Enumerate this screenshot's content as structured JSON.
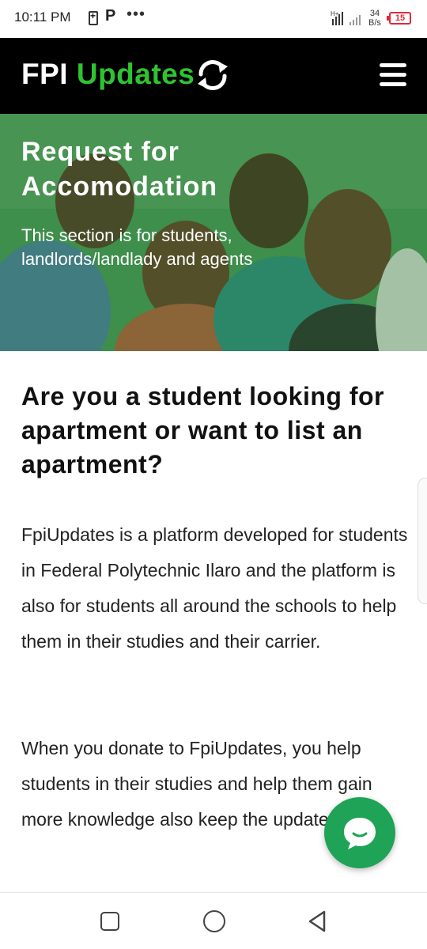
{
  "status_bar": {
    "time": "10:11 PM",
    "p_label": "P",
    "dots": "•••",
    "speed_value": "34",
    "speed_unit": "B/s",
    "battery_level": "15",
    "battery_color": "#e0283a"
  },
  "header": {
    "logo_part1": "FPI",
    "logo_part2": "Updates",
    "brand_color": "#2fc42f",
    "sync_icon": "sync-icon",
    "menu_icon": "hamburger-menu-icon"
  },
  "hero": {
    "title": "Request for Accomodation",
    "subtitle": "This section is for students, landlords/landlady and agents"
  },
  "main": {
    "heading": "Are you a student looking for apartment or want to list an apartment?",
    "paragraph1": "FpiUpdates is a platform developed for students in Federal Polytechnic Ilaro and the platform is also for students all around the schools to help them in their studies and their carrier.",
    "paragraph2": "When you donate to FpiUpdates, you help students in their studies and help them gain more knowledge also keep the updates."
  },
  "chat": {
    "icon": "chat-bubble-icon",
    "color": "#1fa356"
  },
  "nav": {
    "recent_icon": "recent-apps-icon",
    "home_icon": "home-icon",
    "back_icon": "back-icon"
  }
}
